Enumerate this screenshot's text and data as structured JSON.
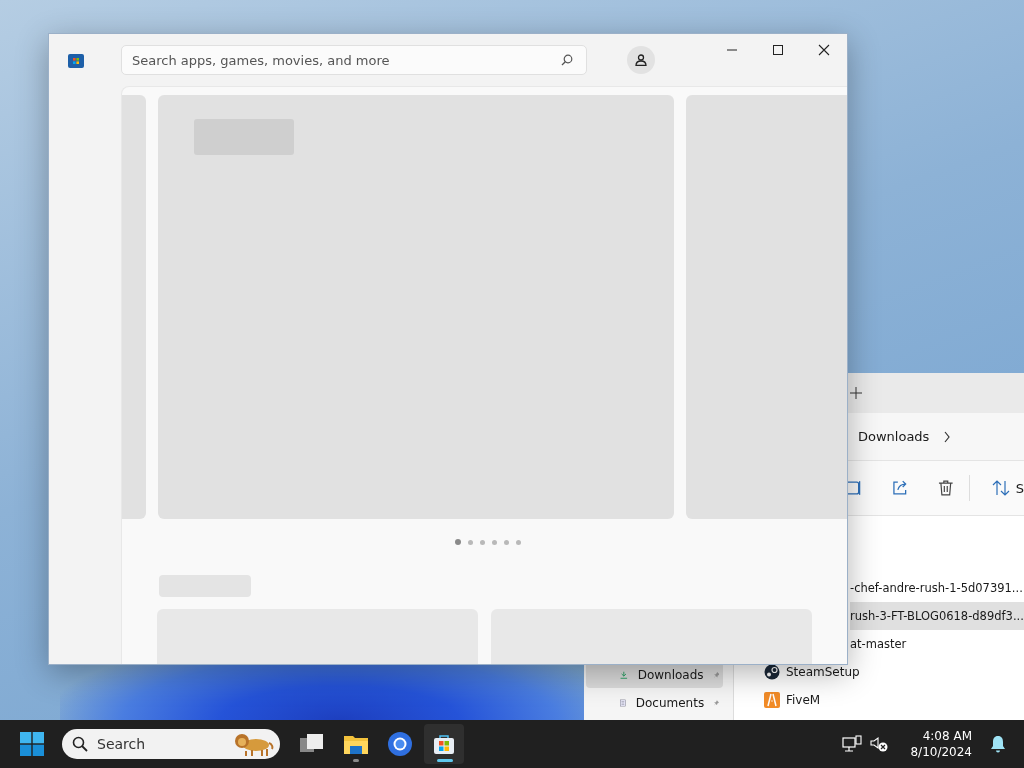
{
  "explorer": {
    "breadcrumb": "Downloads",
    "sort_label": "S",
    "nav": [
      {
        "label": "Downloads",
        "selected": true
      },
      {
        "label": "Documents",
        "selected": false
      }
    ],
    "files": [
      {
        "name": "-chef-andre-rush-1-5d07391...",
        "kind": "cut",
        "selected": false
      },
      {
        "name": "rush-3-FT-BLOG0618-d89df3...",
        "kind": "cut",
        "selected": true
      },
      {
        "name": "at-master",
        "kind": "cut",
        "selected": false
      },
      {
        "name": "SteamSetup",
        "kind": "steam",
        "selected": false
      },
      {
        "name": "FiveM",
        "kind": "fivem",
        "selected": false
      }
    ]
  },
  "store": {
    "search": {
      "placeholder": "Search apps, games, movies, and more"
    },
    "pager": [
      {
        "selected": true
      },
      {
        "selected": false
      },
      {
        "selected": false
      },
      {
        "selected": false
      },
      {
        "selected": false
      },
      {
        "selected": false
      }
    ]
  },
  "taskbar": {
    "search": {
      "placeholder": "Search"
    },
    "apps": [
      {
        "kind": "taskview",
        "active": false,
        "running": false
      },
      {
        "kind": "folder",
        "active": false,
        "running": true
      },
      {
        "kind": "browser",
        "active": false,
        "running": false
      },
      {
        "kind": "store",
        "active": true,
        "running": true
      }
    ],
    "time": "4:08 AM",
    "date": "8/10/2024"
  }
}
